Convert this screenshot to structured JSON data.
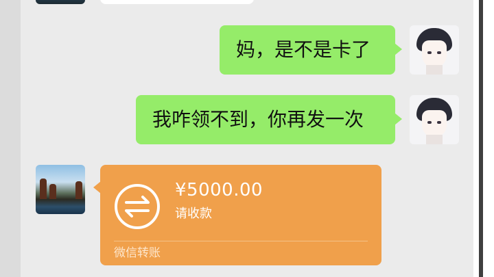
{
  "messages": [
    {
      "from": "me",
      "text": "妈，是不是卡了"
    },
    {
      "from": "me",
      "text": "我咋领不到，你再发一次"
    }
  ],
  "transfer": {
    "amount": "¥5000.00",
    "note": "请收款",
    "footer": "微信转账",
    "icon": "transfer-arrows-icon",
    "color": "#f0a04b"
  },
  "colors": {
    "outgoing_bubble": "#95ec69",
    "background": "#ebebeb"
  }
}
